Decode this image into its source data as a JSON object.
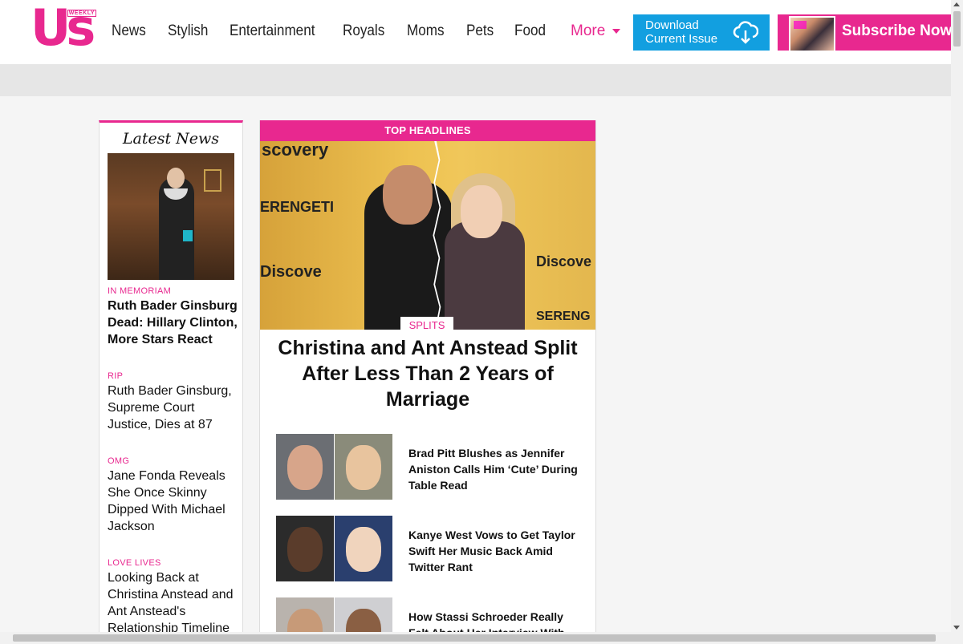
{
  "brand": {
    "logo_text": "Us",
    "logo_sub": "WEEKLY",
    "accent": "#e8288f",
    "download_blue": "#129fe0"
  },
  "nav": {
    "items": [
      "News",
      "Stylish",
      "Entertainment",
      "Royals",
      "Moms",
      "Pets",
      "Food"
    ],
    "more_label": "More"
  },
  "header": {
    "download_line1": "Download",
    "download_line2": "Current Issue",
    "subscribe_label": "Subscribe Now"
  },
  "latest": {
    "heading": "Latest News",
    "items": [
      {
        "kicker": "In Memoriam",
        "title": "Ruth Bader Ginsburg Dead: Hillary Clinton, More Stars React"
      },
      {
        "kicker": "RIP",
        "title": "Ruth Bader Ginsburg, Supreme Court Justice, Dies at 87"
      },
      {
        "kicker": "OMG",
        "title": "Jane Fonda Reveals She Once Skinny Dipped With Michael Jackson"
      },
      {
        "kicker": "Love Lives",
        "title": "Looking Back at Christina Anstead and Ant Anstead's Relationship Timeline"
      }
    ]
  },
  "top_headlines": {
    "label": "TOP HEADLINES",
    "hero_tag": "SPLITS",
    "hero_title": "Christina and Ant Anstead Split After Less Than 2 Years of Marriage",
    "hero_bg_texts": [
      "scovery",
      "ERENGETI",
      "Discove",
      "Discove",
      "SERENG"
    ],
    "stories": [
      {
        "title": "Brad Pitt Blushes as Jennifer Aniston Calls Him ‘Cute’ During Table Read"
      },
      {
        "title": "Kanye West Vows to Get Taylor Swift Her Music Back Amid Twitter Rant"
      },
      {
        "title": "How Stassi Schroeder Really Felt About Her Interview With Tamron"
      }
    ]
  }
}
